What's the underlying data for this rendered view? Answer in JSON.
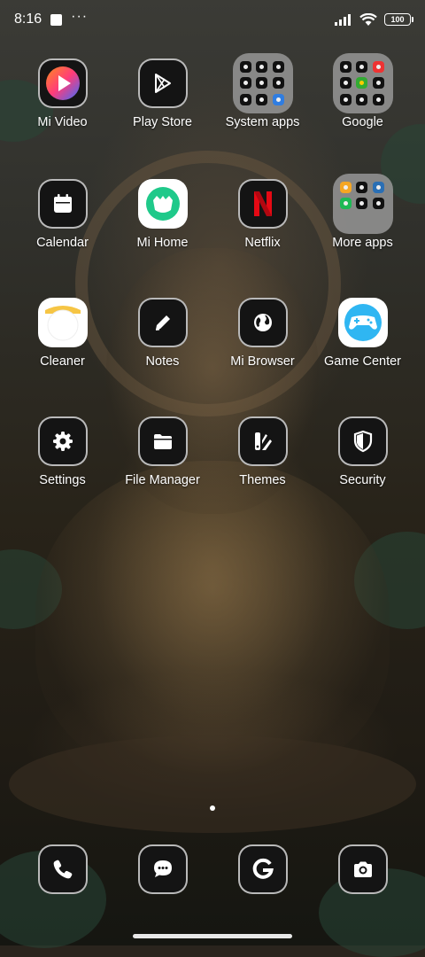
{
  "status_bar": {
    "time": "8:16",
    "dots": "···",
    "battery": "100"
  },
  "apps": [
    {
      "label": "Mi Video",
      "icon": "mi-video-icon"
    },
    {
      "label": "Play Store",
      "icon": "play-store-icon"
    },
    {
      "label": "System apps",
      "icon": "folder-icon"
    },
    {
      "label": "Google",
      "icon": "folder-icon"
    },
    {
      "label": "Calendar",
      "icon": "calendar-icon"
    },
    {
      "label": "Mi Home",
      "icon": "mi-home-icon"
    },
    {
      "label": "Netflix",
      "icon": "netflix-icon"
    },
    {
      "label": "More apps",
      "icon": "folder-icon"
    },
    {
      "label": "Cleaner",
      "icon": "cleaner-icon"
    },
    {
      "label": "Notes",
      "icon": "notes-pencil-icon"
    },
    {
      "label": "Mi Browser",
      "icon": "globe-icon"
    },
    {
      "label": "Game Center",
      "icon": "gamepad-icon"
    },
    {
      "label": "Settings",
      "icon": "gear-icon"
    },
    {
      "label": "File Manager",
      "icon": "folder-file-icon"
    },
    {
      "label": "Themes",
      "icon": "themes-icon"
    },
    {
      "label": "Security",
      "icon": "shield-icon"
    }
  ],
  "dock": [
    {
      "name": "phone",
      "icon": "phone-icon"
    },
    {
      "name": "messages",
      "icon": "chat-bubble-icon"
    },
    {
      "name": "google",
      "icon": "google-g-icon"
    },
    {
      "name": "camera",
      "icon": "camera-icon"
    }
  ]
}
